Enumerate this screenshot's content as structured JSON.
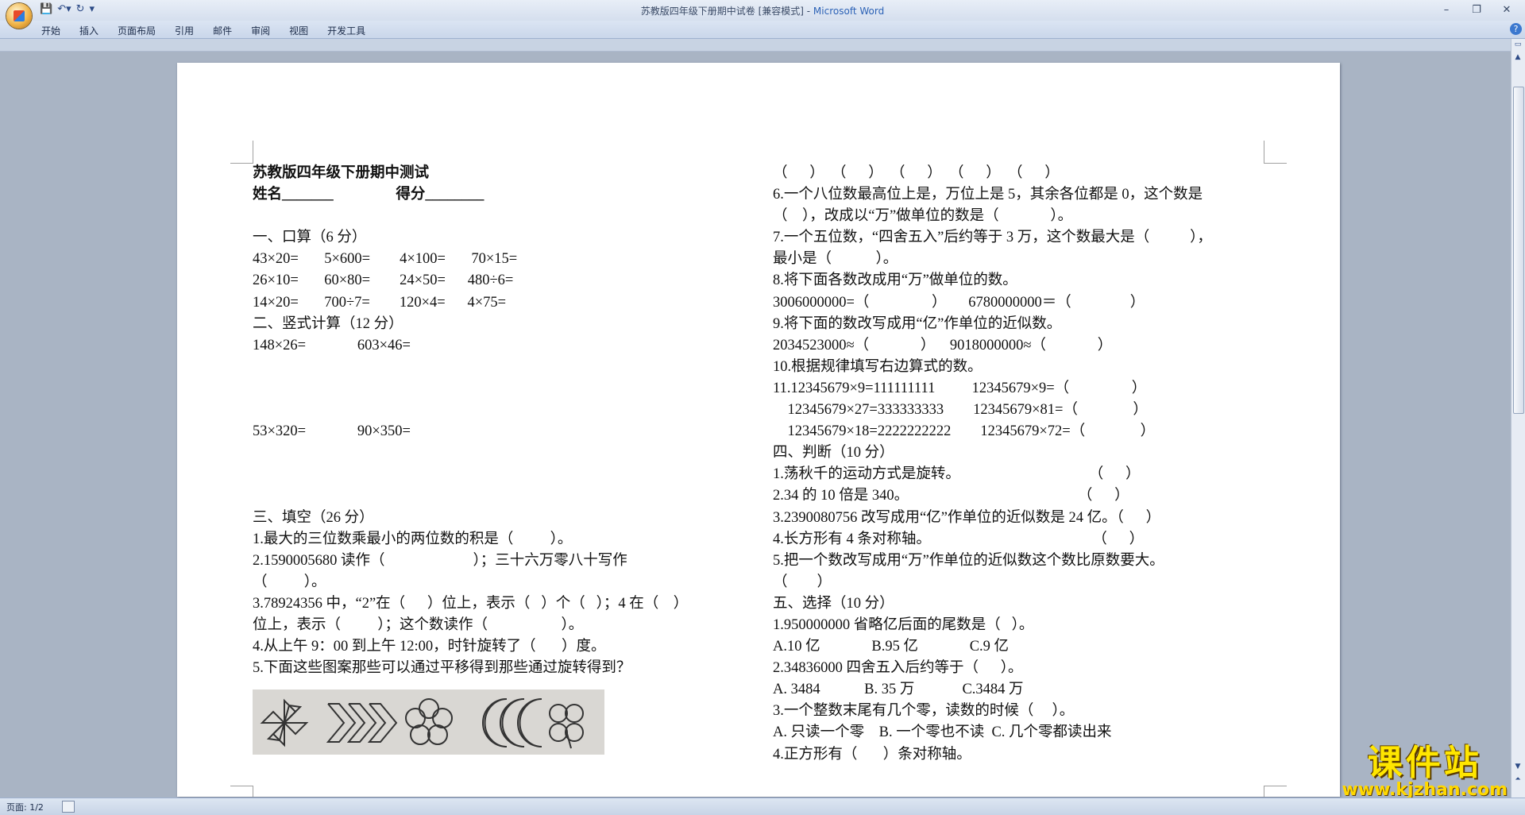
{
  "window": {
    "title": "苏教版四年级下册期中试卷 [兼容模式] - ",
    "app": "Microsoft Word"
  },
  "quick_access": [
    "save-icon",
    "undo-icon",
    "redo-icon",
    "customize-icon"
  ],
  "menu": [
    "开始",
    "插入",
    "页面布局",
    "引用",
    "邮件",
    "审阅",
    "视图",
    "开发工具"
  ],
  "document": {
    "left": [
      {
        "t": "苏教版四年级下册期中测试",
        "b": true
      },
      {
        "t": "姓名_______                 得分________",
        "b": true
      },
      {
        "t": ""
      },
      {
        "t": "一、口算（6 分）"
      },
      {
        "t": "43×20=       5×600=        4×100=       70×15="
      },
      {
        "t": "26×10=       60×80=        24×50=      480÷6="
      },
      {
        "t": "14×20=       700÷7=        120×4=      4×75="
      },
      {
        "t": "二、竖式计算（12 分）"
      },
      {
        "t": "148×26=              603×46="
      },
      {
        "t": ""
      },
      {
        "t": ""
      },
      {
        "t": ""
      },
      {
        "t": "53×320=              90×350="
      },
      {
        "t": ""
      },
      {
        "t": ""
      },
      {
        "t": ""
      },
      {
        "t": "三、填空（26 分）"
      },
      {
        "t": "1.最大的三位数乘最小的两位数的积是（          ）。"
      },
      {
        "t": "2.1590005680 读作（                        ）；三十六万零八十写作"
      },
      {
        "t": "（          ）。"
      },
      {
        "t": "3.78924356 中，“2”在（      ）位上，表示（   ）个（   ）；4 在（    ）"
      },
      {
        "t": "位上，表示（          ）；这个数读作（                    ）。"
      },
      {
        "t": "4.从上午 9：00 到上午 12:00，时针旋转了（       ）度。"
      },
      {
        "t": "5.下面这些图案那些可以通过平移得到那些通过旋转得到？"
      }
    ],
    "right": [
      {
        "t": "（      ）  （      ）  （      ）  （      ）  （      ）"
      },
      {
        "t": "6.一个八位数最高位上是，万位上是 5，其余各位都是 0，这个数是"
      },
      {
        "t": "（    ），改成以“万”做单位的数是（              ）。"
      },
      {
        "t": "7.一个五位数，“四舍五入”后约等于 3 万，这个数最大是（           ），"
      },
      {
        "t": "最小是（            ）。"
      },
      {
        "t": "8.将下面各数改成用“万”做单位的数。"
      },
      {
        "t": "3006000000=（                 ）      6780000000＝（                ）"
      },
      {
        "t": "9.将下面的数改写成用“亿”作单位的近似数。"
      },
      {
        "t": "2034523000≈（              ）    9018000000≈（              ）"
      },
      {
        "t": "10.根据规律填写右边算式的数。"
      },
      {
        "t": "11.12345679×9=111111111          12345679×9=（                 ）"
      },
      {
        "t": "    12345679×27=333333333        12345679×81=（               ）"
      },
      {
        "t": "    12345679×18=2222222222        12345679×72=（               ）"
      },
      {
        "t": "四、判断（10 分）"
      },
      {
        "t": "1.荡秋千的运动方式是旋转。                                   （      ）"
      },
      {
        "t": "2.34 的 10 倍是 340。                                              （      ）"
      },
      {
        "t": "3.2390080756 改写成用“亿”作单位的近似数是 24 亿。（      ）"
      },
      {
        "t": "4.长方形有 4 条对称轴。                                            （      ）"
      },
      {
        "t": "5.把一个数改写成用“万”作单位的近似数这个数比原数要大。"
      },
      {
        "t": "（        ）"
      },
      {
        "t": "五、选择（10 分）"
      },
      {
        "t": "1.950000000 省略亿后面的尾数是（   ）。"
      },
      {
        "t": "A.10 亿              B.95 亿              C.9 亿"
      },
      {
        "t": "2.34836000 四舍五入后约等于（      ）。"
      },
      {
        "t": "A. 3484            B. 35 万             C.3484 万"
      },
      {
        "t": "3.一个整数末尾有几个零，读数的时候（     ）。"
      },
      {
        "t": "A. 只读一个零    B. 一个零也不读  C. 几个零都读出来"
      },
      {
        "t": "4.正方形有（       ）条对称轴。"
      }
    ]
  },
  "watermark": {
    "text": "课件站",
    "url": "www.kjzhan.com"
  },
  "status": {
    "page": "页面: 1/2"
  }
}
